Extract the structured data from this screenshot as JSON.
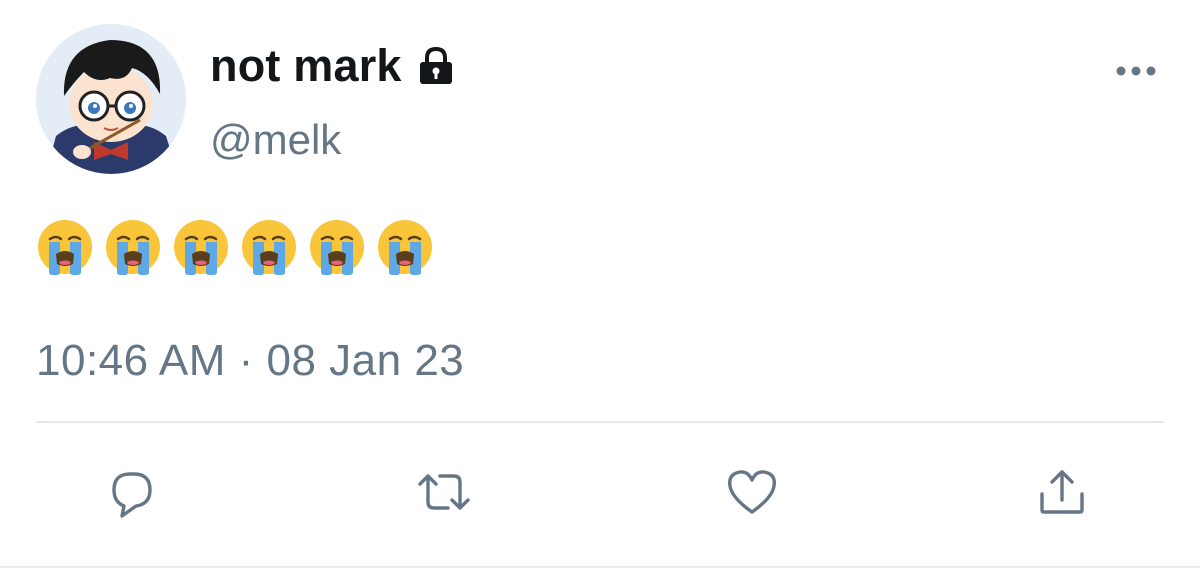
{
  "tweet": {
    "display_name": "not mark",
    "handle": "@melk",
    "text": "😭😭😭😭😭😭",
    "emoji_count": 6,
    "timestamp": "10:46 AM · 08 Jan 23",
    "protected": true
  },
  "icons": {
    "lock": "lock-icon",
    "more": "more-options-icon",
    "reply": "reply-icon",
    "retweet": "retweet-icon",
    "like": "like-icon",
    "share": "share-icon"
  },
  "colors": {
    "text_primary": "#14171a",
    "text_secondary": "#657786",
    "divider": "#e1e8ed",
    "icon": "#657786",
    "emoji_face": "#f9c53b",
    "emoji_tears": "#5fa8e6"
  }
}
